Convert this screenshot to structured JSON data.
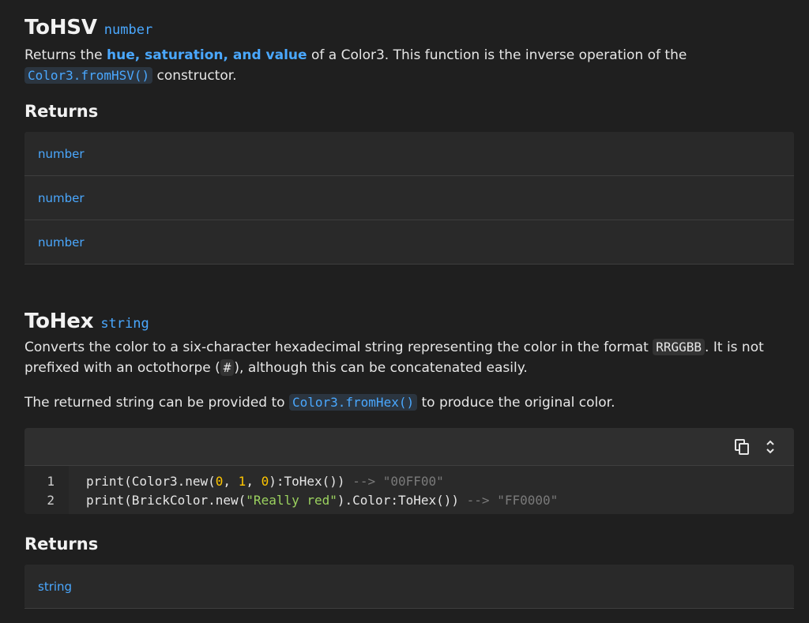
{
  "tohsv": {
    "name": "ToHSV",
    "type": "number",
    "desc_prefix": "Returns the ",
    "desc_link": "hue, saturation, and value",
    "desc_middle": " of a Color3. This function is the inverse operation of the",
    "desc_code": "Color3.fromHSV()",
    "desc_suffix": " constructor.",
    "returns_title": "Returns",
    "returns": [
      "number",
      "number",
      "number"
    ]
  },
  "tohex": {
    "name": "ToHex",
    "type": "string",
    "desc1_prefix": "Converts the color to a six-character hexadecimal string representing the color in the format ",
    "desc1_code": "RRGGBB",
    "desc1_middle": ". It is not prefixed with an octothorpe (",
    "desc1_code2": "#",
    "desc1_suffix": "), although this can be concatenated easily.",
    "desc2_prefix": "The returned string can be provided to ",
    "desc2_code": "Color3.fromHex()",
    "desc2_suffix": " to produce the original color.",
    "code": {
      "line_numbers": [
        "1",
        "2"
      ],
      "line1": {
        "a": "print(Color3.new(",
        "n1": "0",
        "c1": ", ",
        "n2": "1",
        "c2": ", ",
        "n3": "0",
        "b": "):ToHex()) ",
        "comment": "--> \"00FF00\""
      },
      "line2": {
        "a": "print(BrickColor.new(",
        "s": "\"Really red\"",
        "b": ").Color:ToHex()) ",
        "comment": "--> \"FF0000\""
      },
      "icons": [
        "copy-icon",
        "expand-collapse-icon"
      ]
    },
    "returns_title": "Returns",
    "returns": [
      "string"
    ]
  },
  "colors": {
    "background": "#1f1f1f",
    "accent": "#4aa8ff",
    "number_literal": "#ffc600",
    "string_literal": "#9bd25f",
    "comment": "#7a7a7a"
  }
}
